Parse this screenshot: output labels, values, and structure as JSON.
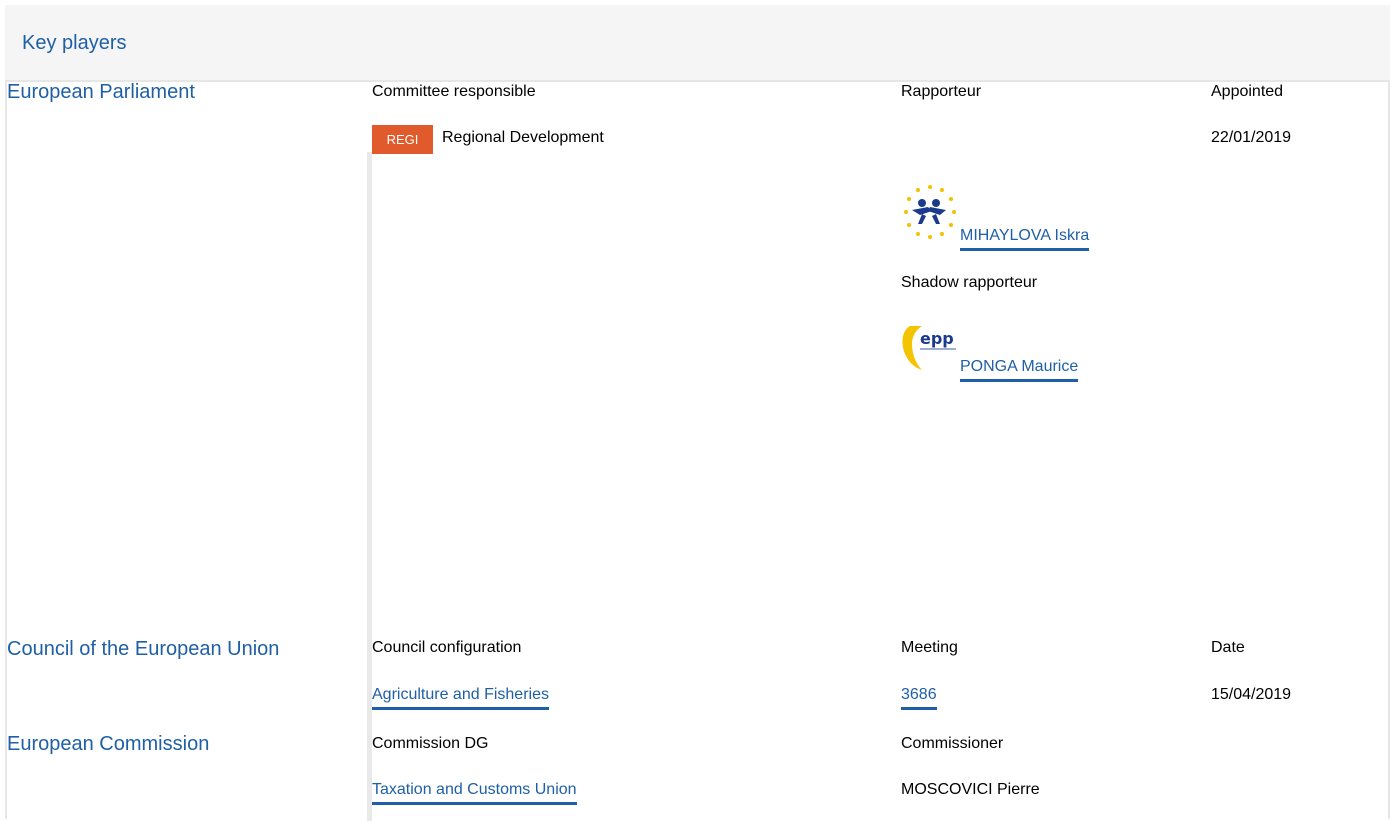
{
  "header": {
    "title": "Key players"
  },
  "parliament": {
    "name": "European Parliament",
    "col_committee": "Committee responsible",
    "col_rapporteur": "Rapporteur",
    "col_appointed": "Appointed",
    "committee_code": "REGI",
    "committee_name": "Regional Development",
    "appointed_date": "22/01/2019",
    "rapporteur_name": "MIHAYLOVA Iskra",
    "shadow_label": "Shadow rapporteur",
    "shadow_name": "PONGA Maurice",
    "shadow_logo_text": "epp",
    "committee_code_color": "#e05a2b"
  },
  "council": {
    "name": "Council of the European Union",
    "col_config": "Council configuration",
    "col_meeting": "Meeting",
    "col_date": "Date",
    "config": "Agriculture and Fisheries",
    "meeting": "3686",
    "date": "15/04/2019"
  },
  "commission": {
    "name": "European Commission",
    "col_dg": "Commission DG",
    "col_commissioner": "Commissioner",
    "dg": "Taxation and Customs Union",
    "commissioner": "MOSCOVICI Pierre"
  },
  "colors": {
    "link": "#1f5fa6",
    "header_bg": "#f5f5f5"
  }
}
